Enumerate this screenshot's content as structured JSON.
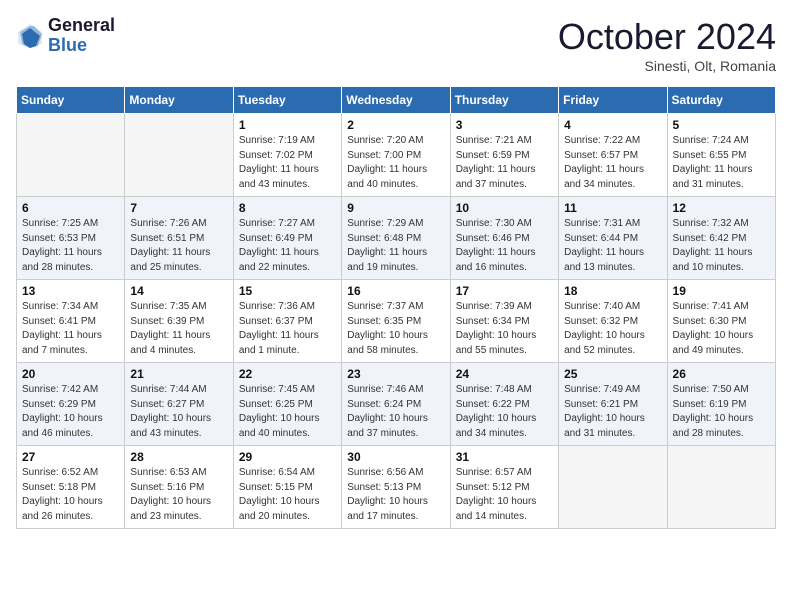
{
  "header": {
    "logo_line1": "General",
    "logo_line2": "Blue",
    "month": "October 2024",
    "location": "Sinesti, Olt, Romania"
  },
  "weekdays": [
    "Sunday",
    "Monday",
    "Tuesday",
    "Wednesday",
    "Thursday",
    "Friday",
    "Saturday"
  ],
  "weeks": [
    [
      {
        "day": "",
        "detail": ""
      },
      {
        "day": "",
        "detail": ""
      },
      {
        "day": "1",
        "detail": "Sunrise: 7:19 AM\nSunset: 7:02 PM\nDaylight: 11 hours and 43 minutes."
      },
      {
        "day": "2",
        "detail": "Sunrise: 7:20 AM\nSunset: 7:00 PM\nDaylight: 11 hours and 40 minutes."
      },
      {
        "day": "3",
        "detail": "Sunrise: 7:21 AM\nSunset: 6:59 PM\nDaylight: 11 hours and 37 minutes."
      },
      {
        "day": "4",
        "detail": "Sunrise: 7:22 AM\nSunset: 6:57 PM\nDaylight: 11 hours and 34 minutes."
      },
      {
        "day": "5",
        "detail": "Sunrise: 7:24 AM\nSunset: 6:55 PM\nDaylight: 11 hours and 31 minutes."
      }
    ],
    [
      {
        "day": "6",
        "detail": "Sunrise: 7:25 AM\nSunset: 6:53 PM\nDaylight: 11 hours and 28 minutes."
      },
      {
        "day": "7",
        "detail": "Sunrise: 7:26 AM\nSunset: 6:51 PM\nDaylight: 11 hours and 25 minutes."
      },
      {
        "day": "8",
        "detail": "Sunrise: 7:27 AM\nSunset: 6:49 PM\nDaylight: 11 hours and 22 minutes."
      },
      {
        "day": "9",
        "detail": "Sunrise: 7:29 AM\nSunset: 6:48 PM\nDaylight: 11 hours and 19 minutes."
      },
      {
        "day": "10",
        "detail": "Sunrise: 7:30 AM\nSunset: 6:46 PM\nDaylight: 11 hours and 16 minutes."
      },
      {
        "day": "11",
        "detail": "Sunrise: 7:31 AM\nSunset: 6:44 PM\nDaylight: 11 hours and 13 minutes."
      },
      {
        "day": "12",
        "detail": "Sunrise: 7:32 AM\nSunset: 6:42 PM\nDaylight: 11 hours and 10 minutes."
      }
    ],
    [
      {
        "day": "13",
        "detail": "Sunrise: 7:34 AM\nSunset: 6:41 PM\nDaylight: 11 hours and 7 minutes."
      },
      {
        "day": "14",
        "detail": "Sunrise: 7:35 AM\nSunset: 6:39 PM\nDaylight: 11 hours and 4 minutes."
      },
      {
        "day": "15",
        "detail": "Sunrise: 7:36 AM\nSunset: 6:37 PM\nDaylight: 11 hours and 1 minute."
      },
      {
        "day": "16",
        "detail": "Sunrise: 7:37 AM\nSunset: 6:35 PM\nDaylight: 10 hours and 58 minutes."
      },
      {
        "day": "17",
        "detail": "Sunrise: 7:39 AM\nSunset: 6:34 PM\nDaylight: 10 hours and 55 minutes."
      },
      {
        "day": "18",
        "detail": "Sunrise: 7:40 AM\nSunset: 6:32 PM\nDaylight: 10 hours and 52 minutes."
      },
      {
        "day": "19",
        "detail": "Sunrise: 7:41 AM\nSunset: 6:30 PM\nDaylight: 10 hours and 49 minutes."
      }
    ],
    [
      {
        "day": "20",
        "detail": "Sunrise: 7:42 AM\nSunset: 6:29 PM\nDaylight: 10 hours and 46 minutes."
      },
      {
        "day": "21",
        "detail": "Sunrise: 7:44 AM\nSunset: 6:27 PM\nDaylight: 10 hours and 43 minutes."
      },
      {
        "day": "22",
        "detail": "Sunrise: 7:45 AM\nSunset: 6:25 PM\nDaylight: 10 hours and 40 minutes."
      },
      {
        "day": "23",
        "detail": "Sunrise: 7:46 AM\nSunset: 6:24 PM\nDaylight: 10 hours and 37 minutes."
      },
      {
        "day": "24",
        "detail": "Sunrise: 7:48 AM\nSunset: 6:22 PM\nDaylight: 10 hours and 34 minutes."
      },
      {
        "day": "25",
        "detail": "Sunrise: 7:49 AM\nSunset: 6:21 PM\nDaylight: 10 hours and 31 minutes."
      },
      {
        "day": "26",
        "detail": "Sunrise: 7:50 AM\nSunset: 6:19 PM\nDaylight: 10 hours and 28 minutes."
      }
    ],
    [
      {
        "day": "27",
        "detail": "Sunrise: 6:52 AM\nSunset: 5:18 PM\nDaylight: 10 hours and 26 minutes."
      },
      {
        "day": "28",
        "detail": "Sunrise: 6:53 AM\nSunset: 5:16 PM\nDaylight: 10 hours and 23 minutes."
      },
      {
        "day": "29",
        "detail": "Sunrise: 6:54 AM\nSunset: 5:15 PM\nDaylight: 10 hours and 20 minutes."
      },
      {
        "day": "30",
        "detail": "Sunrise: 6:56 AM\nSunset: 5:13 PM\nDaylight: 10 hours and 17 minutes."
      },
      {
        "day": "31",
        "detail": "Sunrise: 6:57 AM\nSunset: 5:12 PM\nDaylight: 10 hours and 14 minutes."
      },
      {
        "day": "",
        "detail": ""
      },
      {
        "day": "",
        "detail": ""
      }
    ]
  ]
}
